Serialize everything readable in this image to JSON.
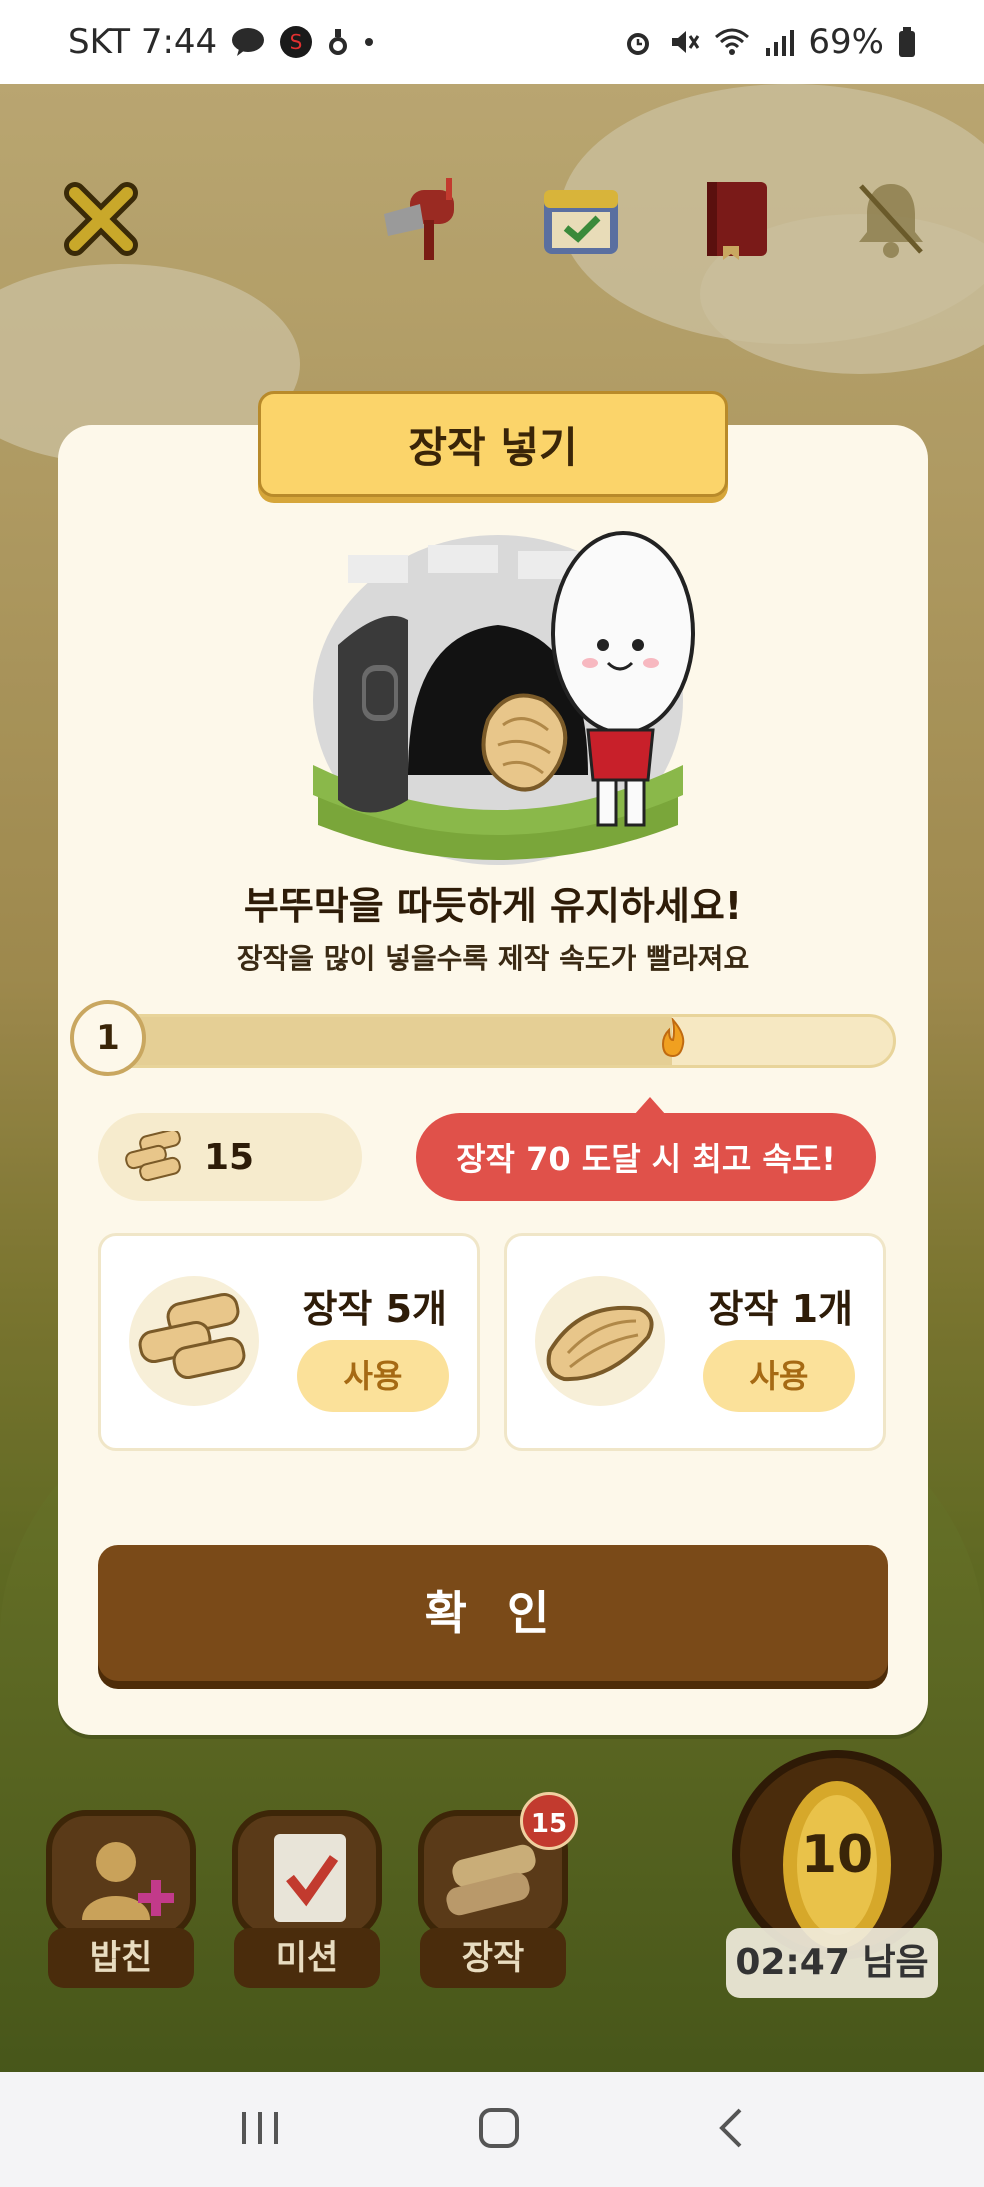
{
  "status_bar": {
    "carrier_time": "SKT 7:44",
    "battery": "69%"
  },
  "dialog": {
    "title": "장작 넣기",
    "headline": "부뚜막을 따듯하게 유지하세요!",
    "subline": "장작을 많이 넣을수록 제작 속도가 빨라져요",
    "level": "1",
    "progress_fraction": 0.72,
    "wood_count": "15",
    "tip": "장작 70 도달 시 최고 속도!",
    "items": [
      {
        "label": "장작 5개",
        "button": "사용"
      },
      {
        "label": "장작 1개",
        "button": "사용"
      }
    ],
    "confirm": "확 인"
  },
  "bottom_nav": {
    "items": [
      {
        "label": "밥친"
      },
      {
        "label": "미션"
      },
      {
        "label": "장작",
        "badge": "15"
      }
    ],
    "timer_level": "10",
    "timer_text": "02:47 남음"
  },
  "colors": {
    "accent": "#fbd46a",
    "confirm": "#7a4a18",
    "tip": "#e0514a"
  }
}
